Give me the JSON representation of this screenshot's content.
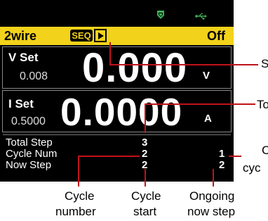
{
  "status": {
    "mode": "2wire",
    "seq_badge": "SEQ",
    "output": "Off"
  },
  "voltage": {
    "label": "V Set",
    "set_value": "0.008",
    "reading": "0.000",
    "unit": "V"
  },
  "current": {
    "label": "I Set",
    "set_value": "0.5000",
    "reading": "0.0000",
    "unit": "A"
  },
  "sequence": {
    "total_step_label": "Total Step",
    "total_step_value": "3",
    "cycle_num_label": "Cycle Num",
    "cycle_num_value": "2",
    "cycle_num_right": "1",
    "now_step_label": "Now Step",
    "now_step_value": "2",
    "now_step_right": "2"
  },
  "annotations": {
    "right_1": "S",
    "right_2": "To",
    "right_3_line1": "C",
    "right_3_line2": "cyc",
    "bottom_1_line1": "Cycle",
    "bottom_1_line2": "number",
    "bottom_2_line1": "Cycle",
    "bottom_2_line2": "start",
    "bottom_3_line1": "Ongoing",
    "bottom_3_line2": "now step"
  },
  "colors": {
    "status_bar": "#f2d21a",
    "screen_bg": "#000000",
    "callout_line": "#c0121a",
    "icon_green": "#3fae55"
  },
  "icons": [
    "shield-icon",
    "usb-icon",
    "play-icon"
  ]
}
